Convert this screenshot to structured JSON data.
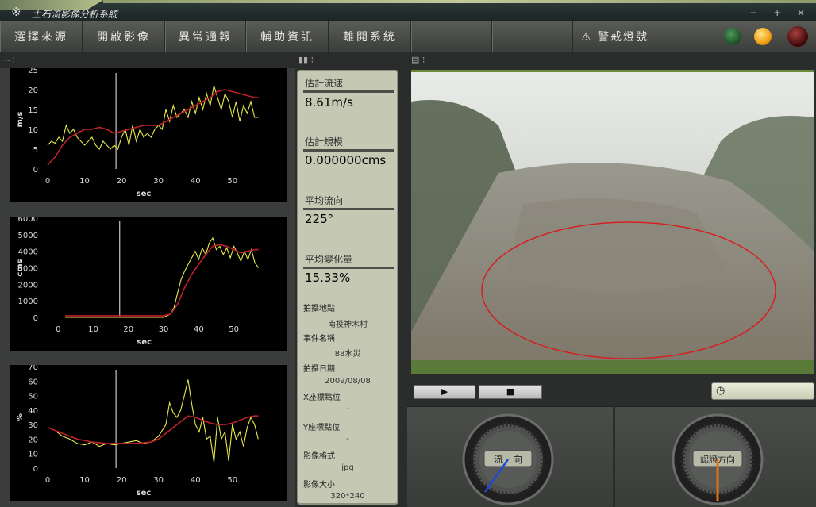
{
  "window": {
    "title": "土石流影像分析系統",
    "symbol": "※",
    "controls": "− + ×"
  },
  "menu": {
    "items": [
      {
        "label": "選擇來源"
      },
      {
        "label": "開啟影像"
      },
      {
        "label": "異常通報"
      },
      {
        "label": "輔助資訊"
      },
      {
        "label": "離開系統"
      }
    ],
    "warning_label": "警戒燈號",
    "lights": [
      {
        "name": "green-light",
        "color": "#1f5a2a"
      },
      {
        "name": "orange-light",
        "color": "#f5a623"
      },
      {
        "name": "red-light",
        "color": "#5a0f0f"
      }
    ]
  },
  "info": {
    "velocity_label": "估計流速",
    "velocity_value": "8.61m/s",
    "scale_label": "估計規模",
    "scale_value": "0.000000cms",
    "direction_label": "平均流向",
    "direction_value": "225°",
    "change_label": "平均變化量",
    "change_value": "15.33%",
    "meta": [
      {
        "label": "拍攝地點",
        "value": "南投神木村"
      },
      {
        "label": "事件名稱",
        "value": "88水災"
      },
      {
        "label": "拍攝日期",
        "value": "2009/08/08"
      },
      {
        "label": "X座標點位",
        "value": "-"
      },
      {
        "label": "Y座標點位",
        "value": "-"
      },
      {
        "label": "影像格式",
        "value": "jpg"
      },
      {
        "label": "影像大小",
        "value": "320*240"
      }
    ]
  },
  "gauges": {
    "left_label": "流　向",
    "right_label": "認證方向"
  },
  "colors": {
    "yellow_series": "#e8e84a",
    "red_series": "#c0202a",
    "cursor": "#c8c8c8",
    "roi_ellipse": "#d42020"
  },
  "chart_data": [
    {
      "type": "line",
      "ylabel": "m/s",
      "xlabel": "sec",
      "xlim": [
        0,
        58
      ],
      "ylim": [
        0,
        25
      ],
      "xticks": [
        0,
        10,
        20,
        30,
        40,
        50
      ],
      "yticks": [
        0,
        5,
        10,
        15,
        20,
        25
      ],
      "cursor_x": 18.5,
      "series": [
        {
          "color": "yellow",
          "x": [
            0,
            1,
            2,
            3,
            4,
            5,
            6,
            7,
            8,
            9,
            10,
            11,
            12,
            13,
            14,
            15,
            16,
            17,
            18,
            19,
            20,
            21,
            22,
            23,
            24,
            25,
            26,
            27,
            28,
            29,
            30,
            31,
            32,
            33,
            34,
            35,
            36,
            37,
            38,
            39,
            40,
            41,
            42,
            43,
            44,
            45,
            46,
            47,
            48,
            49,
            50,
            51,
            52,
            53,
            54,
            55,
            56,
            57
          ],
          "y": [
            6,
            7,
            6.5,
            8,
            7,
            11,
            9,
            10,
            8,
            7,
            6,
            7,
            8,
            6,
            5,
            7,
            6,
            5,
            6,
            5,
            8,
            10,
            6,
            11,
            7,
            10,
            8,
            9,
            8,
            10,
            11,
            10,
            15,
            12,
            16,
            13,
            14,
            15,
            13,
            17,
            14,
            18,
            15,
            19,
            16,
            21,
            18,
            15,
            19,
            17,
            13,
            17,
            12,
            16,
            14,
            17,
            13,
            13
          ]
        },
        {
          "color": "red",
          "x": [
            0,
            2,
            4,
            6,
            8,
            10,
            12,
            14,
            16,
            18,
            20,
            22,
            24,
            26,
            28,
            30,
            32,
            34,
            36,
            38,
            40,
            42,
            44,
            46,
            48,
            50,
            52,
            54,
            56,
            57
          ],
          "y": [
            1,
            3,
            6,
            8,
            9,
            10,
            10,
            10.5,
            10,
            9,
            9.5,
            10,
            10.5,
            11,
            11,
            11,
            12,
            13,
            14,
            15,
            16,
            17,
            18,
            19.5,
            20,
            19.5,
            19,
            18.5,
            18,
            18
          ]
        }
      ]
    },
    {
      "type": "line",
      "ylabel": "cms",
      "xlabel": "sec",
      "xlim": [
        -3,
        58
      ],
      "ylim": [
        0,
        6000
      ],
      "xticks": [
        0,
        10,
        20,
        30,
        40,
        50
      ],
      "yticks": [
        0,
        1000,
        2000,
        3000,
        4000,
        5000,
        6000
      ],
      "cursor_x": 17.5,
      "series": [
        {
          "color": "yellow",
          "x": [
            2,
            6,
            10,
            14,
            18,
            22,
            26,
            28,
            30,
            32,
            33,
            34,
            35,
            36,
            37,
            38,
            39,
            40,
            41,
            42,
            43,
            44,
            45,
            46,
            47,
            48,
            49,
            50,
            51,
            52,
            53,
            54,
            55,
            56,
            57
          ],
          "y": [
            0,
            0,
            0,
            0,
            0,
            0,
            0,
            0,
            0,
            200,
            600,
            1500,
            2300,
            2800,
            3200,
            3600,
            4000,
            3500,
            4200,
            3800,
            4500,
            4800,
            4100,
            4300,
            3800,
            4200,
            3600,
            4300,
            3900,
            3400,
            4000,
            3500,
            4100,
            3300,
            3000
          ]
        },
        {
          "color": "red",
          "x": [
            2,
            6,
            10,
            14,
            18,
            22,
            26,
            28,
            30,
            32,
            34,
            36,
            38,
            40,
            42,
            44,
            46,
            48,
            50,
            52,
            54,
            56,
            57
          ],
          "y": [
            100,
            100,
            100,
            100,
            100,
            100,
            100,
            100,
            100,
            200,
            800,
            1800,
            2600,
            3200,
            3800,
            4300,
            4400,
            4300,
            4100,
            3900,
            4000,
            4100,
            4100
          ]
        }
      ]
    },
    {
      "type": "line",
      "ylabel": "%",
      "xlabel": "sec",
      "xlim": [
        0,
        58
      ],
      "ylim": [
        0,
        70
      ],
      "xticks": [
        0,
        10,
        20,
        30,
        40,
        50
      ],
      "yticks": [
        0,
        10,
        20,
        30,
        40,
        50,
        60,
        70
      ],
      "cursor_x": 18.5,
      "series": [
        {
          "color": "yellow",
          "x": [
            0,
            2,
            4,
            6,
            8,
            10,
            12,
            14,
            16,
            18,
            20,
            22,
            24,
            26,
            28,
            30,
            32,
            33,
            34,
            35,
            36,
            37,
            38,
            39,
            40,
            41,
            42,
            43,
            44,
            45,
            46,
            47,
            48,
            49,
            50,
            51,
            52,
            53,
            54,
            55,
            56,
            57
          ],
          "y": [
            28,
            26,
            22,
            20,
            17,
            16,
            18,
            15,
            17,
            16,
            17,
            18,
            19,
            17,
            18,
            22,
            30,
            45,
            38,
            35,
            40,
            50,
            61,
            44,
            30,
            25,
            35,
            20,
            22,
            4,
            35,
            20,
            25,
            5,
            30,
            20,
            25,
            15,
            28,
            35,
            30,
            20
          ]
        },
        {
          "color": "red",
          "x": [
            0,
            4,
            8,
            12,
            16,
            20,
            24,
            28,
            30,
            32,
            34,
            36,
            38,
            40,
            42,
            44,
            46,
            48,
            50,
            52,
            54,
            56,
            57
          ],
          "y": [
            28,
            24,
            20,
            18,
            17,
            17,
            17,
            18,
            20,
            24,
            28,
            32,
            36,
            35,
            33,
            31,
            30,
            30,
            31,
            33,
            35,
            36,
            36
          ]
        }
      ]
    }
  ]
}
